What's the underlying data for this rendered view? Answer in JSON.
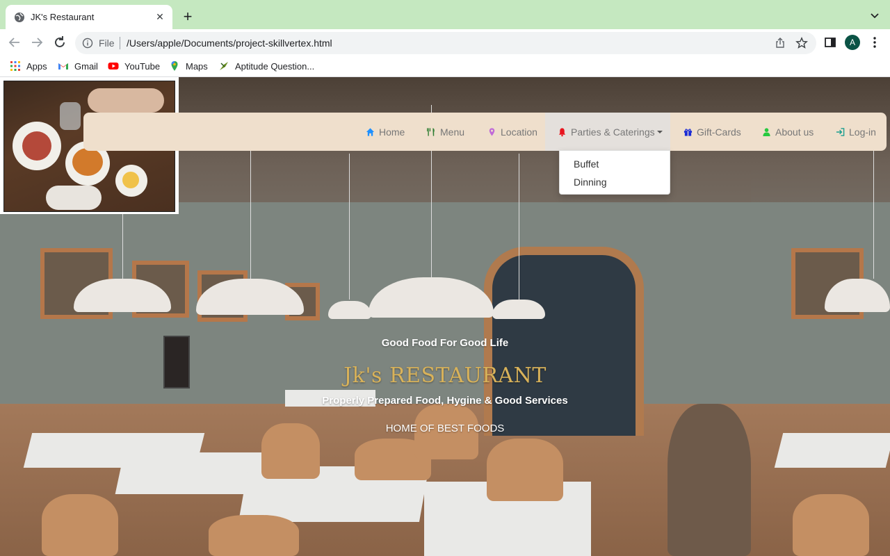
{
  "browser": {
    "tab_title": "JK's Restaurant",
    "tab_close": "✕",
    "new_tab": "+",
    "url_scheme": "File",
    "url": "/Users/apple/Documents/project-skillvertex.html",
    "profile_initial": "A"
  },
  "bookmarks": [
    {
      "label": "Apps",
      "icon": "apps-grid-icon"
    },
    {
      "label": "Gmail",
      "icon": "gmail-icon"
    },
    {
      "label": "YouTube",
      "icon": "youtube-icon"
    },
    {
      "label": "Maps",
      "icon": "maps-icon"
    },
    {
      "label": "Aptitude Question...",
      "icon": "aptitude-icon"
    }
  ],
  "nav": {
    "items": [
      {
        "label": "Home",
        "icon": "home-icon",
        "color": "#1e90ff"
      },
      {
        "label": "Menu",
        "icon": "cutlery-icon",
        "color": "#2e7d32"
      },
      {
        "label": "Location",
        "icon": "map-marker-icon",
        "color": "#c06ad8"
      },
      {
        "label": "Parties & Caterings",
        "icon": "bell-icon",
        "color": "#e8141e"
      },
      {
        "label": "Gift-Cards",
        "icon": "gift-icon",
        "color": "#1a2bd6"
      },
      {
        "label": "About us",
        "icon": "user-icon",
        "color": "#27c93f"
      },
      {
        "label": "Log-in",
        "icon": "login-icon",
        "color": "#1a9e8f"
      }
    ],
    "dropdown": [
      "Buffet",
      "Dinning"
    ]
  },
  "hero": {
    "tagline": "Good Food For Good Life",
    "brand": "Jk's RESTAURANT",
    "subtitle": "Properly Prepared Food, Hygine & Good Services",
    "home_best": "HOME OF BEST FOODS"
  },
  "colors": {
    "tab_bar": "#c5e8c0",
    "navbar": "#efdfcc",
    "brand_gold": "#d8b25a"
  }
}
